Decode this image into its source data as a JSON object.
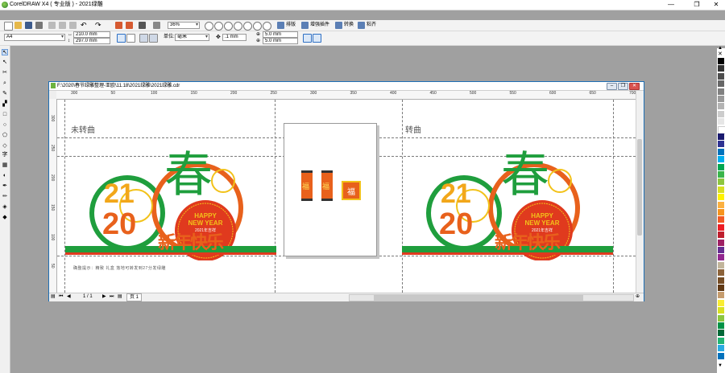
{
  "window": {
    "title": "CorelDRAW X4 ( 专业版 ) - 2021绿雕",
    "controls": [
      "—",
      "❐",
      "✕"
    ]
  },
  "toolbar": {
    "zoom_value": "36%",
    "snap_label": "贴齐",
    "arrange_label": "排版",
    "convert_label": "转换",
    "effects_label": "增强插件",
    "paste_label": "粘齐"
  },
  "property_bar": {
    "paper_size": "A4",
    "width": "210.0 mm",
    "height": "297.0 mm",
    "units_label": "单位:",
    "units_value": "毫米",
    "nudge_value": ".1 mm",
    "dup_x": "5.0 mm",
    "dup_y": "5.0 mm"
  },
  "document": {
    "title": "F:\\2020\\春节绿雕整理-亚欧\\11.18\\2021绿雕\\2021绿雕.cdr",
    "left_label": "未转曲",
    "right_label": "转曲",
    "note": "确整提示：精致 礼盒 落地可转发到27分发绿雕",
    "page_nav": "1 / 1",
    "page_tab": "页 1",
    "design": {
      "year_top": "21",
      "year_bottom": "20",
      "big_char": "春",
      "banner": "HAPPY",
      "banner2": "NEW YEAR",
      "year_caption": "2021年吉祥",
      "slogan": "新年快乐",
      "fu": "福"
    },
    "hruler_ticks": [
      "300",
      "350",
      "400",
      "450",
      "500",
      "550",
      "600",
      "650",
      "700",
      "750",
      "800",
      "850",
      "900",
      "950",
      "1000",
      "1050",
      "1100",
      "1150",
      "1200",
      "1250"
    ],
    "hruler_display": [
      "300",
      "50",
      "100",
      "150",
      "200",
      "250",
      "300",
      "350",
      "400",
      "450",
      "500",
      "550",
      "600",
      "650",
      "700",
      "750"
    ],
    "vruler_ticks": [
      "300",
      "250",
      "200",
      "150",
      "100",
      "50"
    ]
  },
  "colors": {
    "orange": "#e8611c",
    "green": "#1f9e3d",
    "yellow": "#f2c21a",
    "red": "#e03a1e"
  }
}
